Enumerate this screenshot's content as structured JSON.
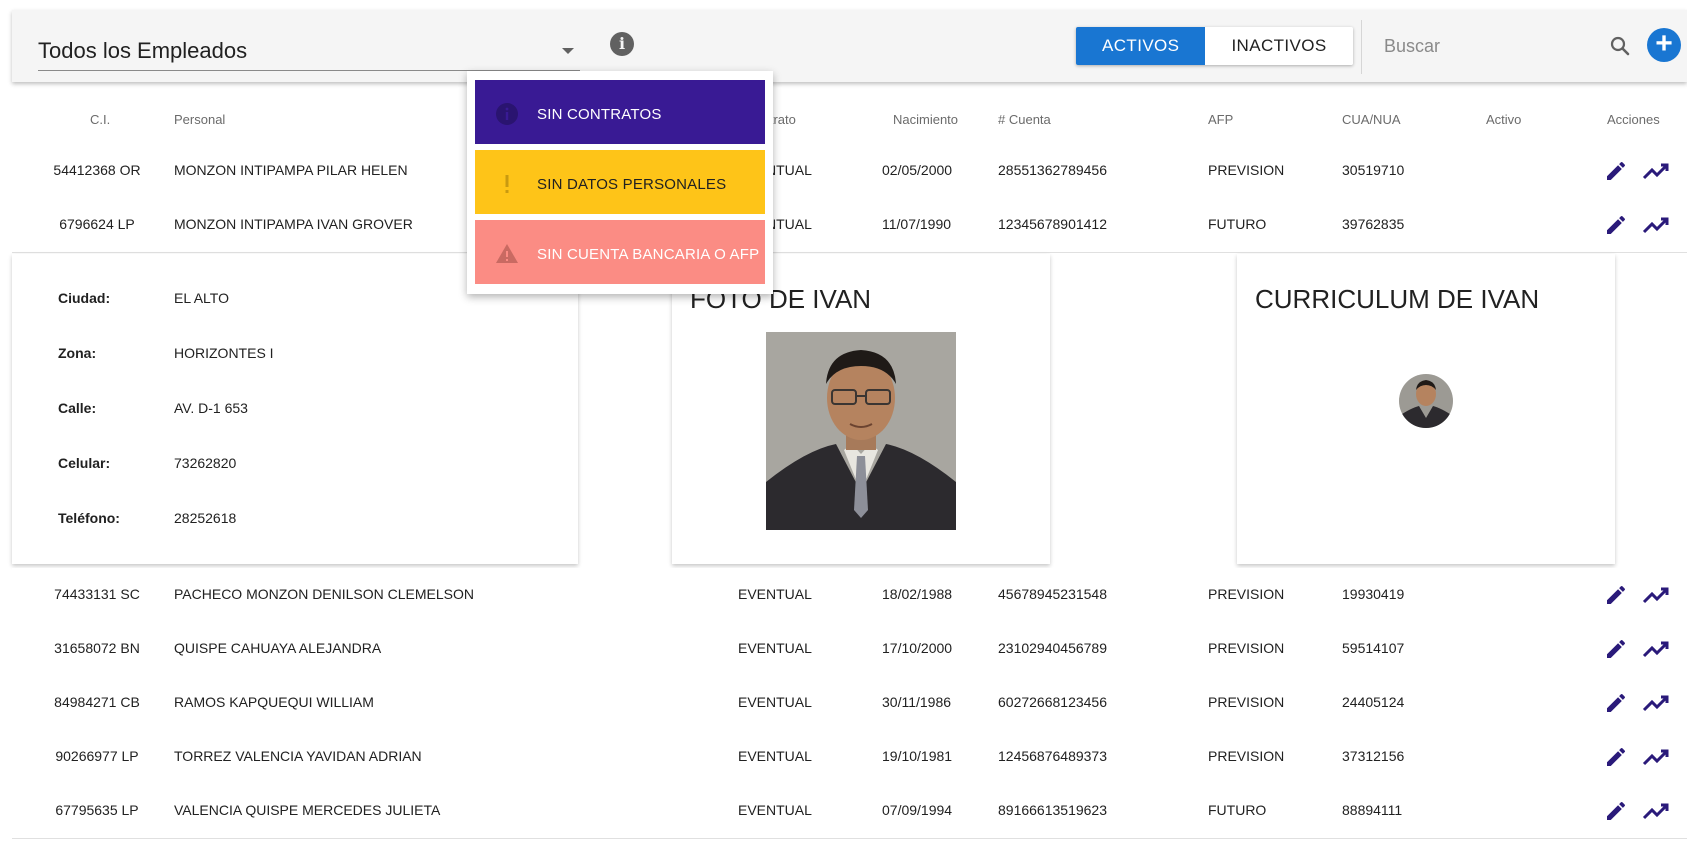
{
  "toolbar": {
    "filter_value": "Todos los Empleados",
    "toggle_active": "ACTIVOS",
    "toggle_inactive": "INACTIVOS",
    "search_placeholder": "Buscar"
  },
  "colors": {
    "primary": "#1976d2",
    "purple": "#391a94",
    "warning": "#fec418",
    "danger": "#fb8c84",
    "action_icon": "#2a1a7a"
  },
  "table": {
    "headers": {
      "ci": "C.I.",
      "personal": "Personal",
      "contrato": "Contrato",
      "nacimiento": "Nacimiento",
      "cuenta": "# Cuenta",
      "afp": "AFP",
      "cua": "CUA/NUA",
      "activo": "Activo",
      "acciones": "Acciones"
    },
    "rows": [
      {
        "ci": "54412368 OR",
        "name": "MONZON INTIPAMPA PILAR HELEN",
        "contrato": "EVENTUAL",
        "nacimiento": "02/05/2000",
        "cuenta": "28551362789456",
        "afp": "PREVISION",
        "cua": "30519710"
      },
      {
        "ci": "6796624 LP",
        "name": "MONZON INTIPAMPA IVAN GROVER",
        "contrato": "EVENTUAL",
        "nacimiento": "11/07/1990",
        "cuenta": "12345678901412",
        "afp": "FUTURO",
        "cua": "39762835"
      },
      {
        "ci": "74433131 SC",
        "name": "PACHECO MONZON DENILSON CLEMELSON",
        "contrato": "EVENTUAL",
        "nacimiento": "18/02/1988",
        "cuenta": "45678945231548",
        "afp": "PREVISION",
        "cua": "19930419"
      },
      {
        "ci": "31658072 BN",
        "name": "QUISPE CAHUAYA ALEJANDRA",
        "contrato": "EVENTUAL",
        "nacimiento": "17/10/2000",
        "cuenta": "23102940456789",
        "afp": "PREVISION",
        "cua": "59514107"
      },
      {
        "ci": "84984271 CB",
        "name": "RAMOS KAPQUEQUI WILLIAM",
        "contrato": "EVENTUAL",
        "nacimiento": "30/11/1986",
        "cuenta": "60272668123456",
        "afp": "PREVISION",
        "cua": "24405124"
      },
      {
        "ci": "90266977 LP",
        "name": "TORREZ VALENCIA YAVIDAN ADRIAN",
        "contrato": "EVENTUAL",
        "nacimiento": "19/10/1981",
        "cuenta": "12456876489373",
        "afp": "PREVISION",
        "cua": "37312156"
      },
      {
        "ci": "67795635 LP",
        "name": "VALENCIA QUISPE MERCEDES JULIETA",
        "contrato": "EVENTUAL",
        "nacimiento": "07/09/1994",
        "cuenta": "89166613519623",
        "afp": "FUTURO",
        "cua": "88894111"
      }
    ]
  },
  "detail": {
    "fields": [
      {
        "label": "Ciudad:",
        "value": "EL ALTO"
      },
      {
        "label": "Zona:",
        "value": "HORIZONTES I"
      },
      {
        "label": "Calle:",
        "value": "AV. D-1 653"
      },
      {
        "label": "Celular:",
        "value": "73262820"
      },
      {
        "label": "Teléfono:",
        "value": "28252618"
      }
    ],
    "photo_title": "FOTO DE IVAN",
    "cv_title": "CURRICULUM DE IVAN"
  },
  "menu": {
    "items": [
      {
        "label": "SIN CONTRATOS",
        "icon": "info-icon"
      },
      {
        "label": "SIN DATOS PERSONALES",
        "icon": "exclamation-icon"
      },
      {
        "label": "SIN CUENTA BANCARIA O AFP",
        "icon": "warning-icon"
      }
    ]
  }
}
